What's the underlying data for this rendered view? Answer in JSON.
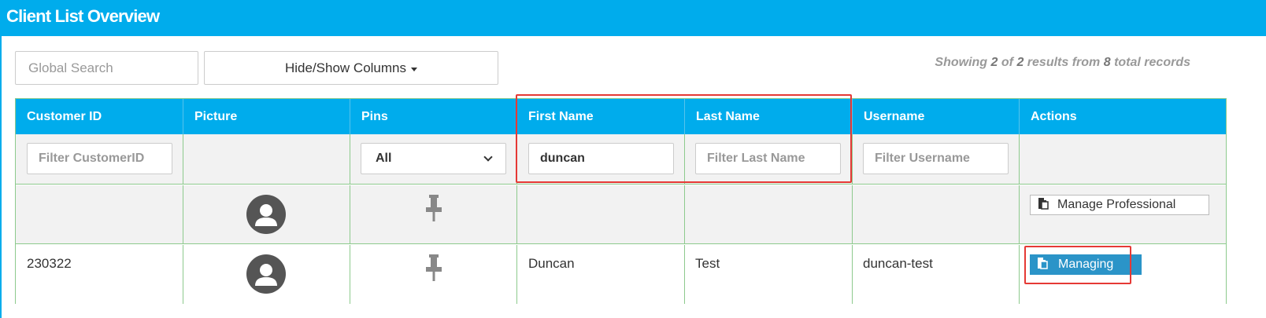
{
  "header": {
    "title": "Client List Overview"
  },
  "toolbar": {
    "search_placeholder": "Global Search",
    "columns_button": "Hide/Show Columns",
    "showing_prefix": "Showing",
    "showing_count": "2",
    "showing_of": "of",
    "showing_total": "2",
    "showing_results_from": "results from",
    "showing_records": "8",
    "showing_suffix": "total records"
  },
  "table": {
    "columns": [
      "Customer ID",
      "Picture",
      "Pins",
      "First Name",
      "Last Name",
      "Username",
      "Actions"
    ],
    "filters": {
      "customer_id_placeholder": "Filter CustomerID",
      "pins_selected": "All",
      "first_name_value": "duncan",
      "last_name_placeholder": "Filter Last Name",
      "username_placeholder": "Filter Username"
    },
    "rows": [
      {
        "customer_id": "",
        "first_name": "",
        "last_name": "",
        "username": "",
        "action": "Manage Professional",
        "action_style": "default"
      },
      {
        "customer_id": "230322",
        "first_name": "Duncan",
        "last_name": "Test",
        "username": "duncan-test",
        "action": "Managing",
        "action_style": "active"
      }
    ]
  },
  "icons": {
    "avatar": "user-avatar-icon",
    "pin": "pushpin-icon",
    "action": "copy-icon"
  },
  "colors": {
    "header": "#00acec",
    "grid_border": "#8dca8d",
    "active_button": "#2b94c8",
    "highlight": "#e53935"
  }
}
